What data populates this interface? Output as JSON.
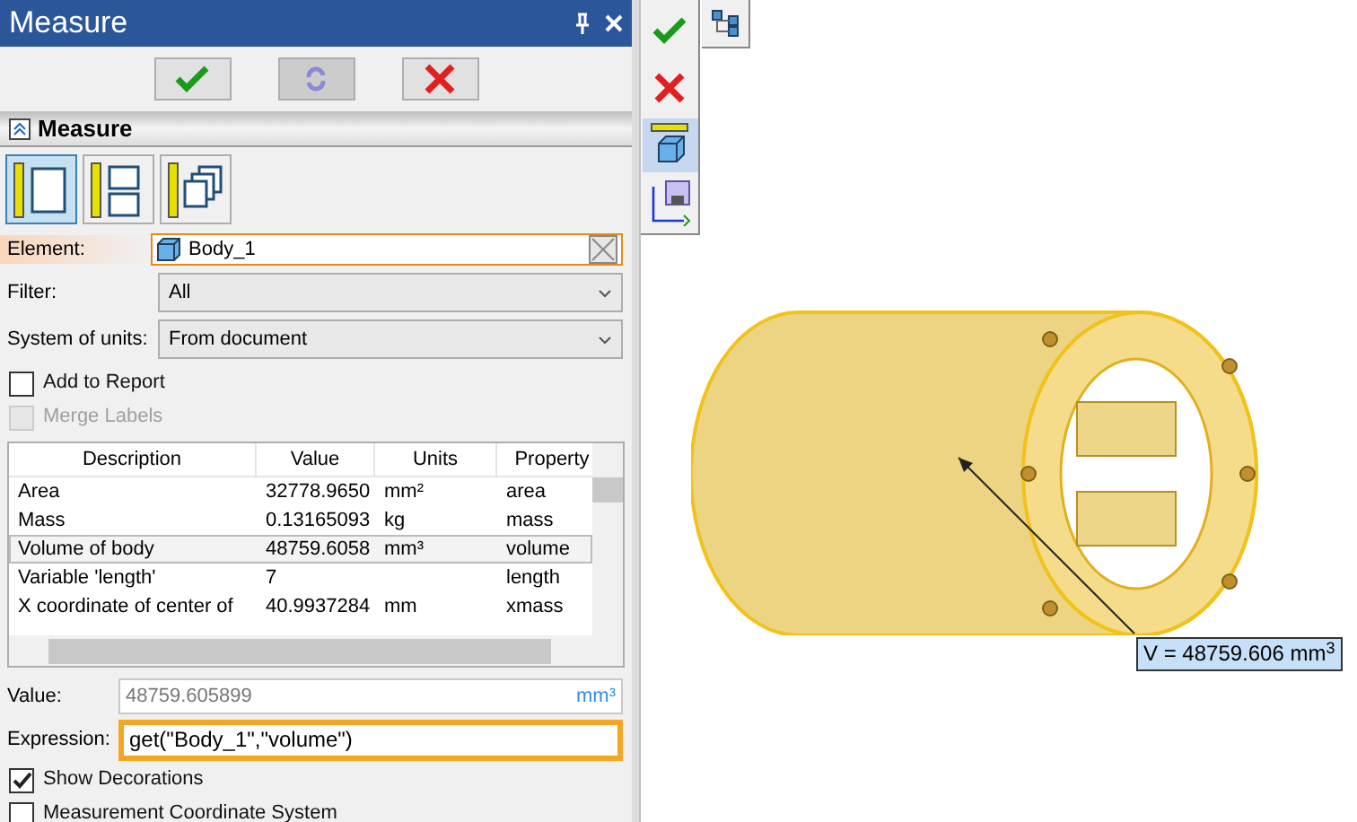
{
  "panel": {
    "title": "Measure",
    "section": "Measure",
    "expanded": true
  },
  "actions": [
    {
      "kind": "ok",
      "disabled": false
    },
    {
      "kind": "refresh",
      "disabled": true
    },
    {
      "kind": "cancel",
      "disabled": false
    }
  ],
  "modes": [
    {
      "kind": "single",
      "selected": true
    },
    {
      "kind": "split",
      "selected": false
    },
    {
      "kind": "stack",
      "selected": false
    }
  ],
  "element": {
    "label": "Element:",
    "value": "Body_1"
  },
  "filter": {
    "label": "Filter:",
    "value": "All"
  },
  "units": {
    "label": "System of units:",
    "value": "From document"
  },
  "options_top": [
    {
      "label": "Add to Report",
      "checked": false,
      "disabled": false
    },
    {
      "label": "Merge Labels",
      "checked": false,
      "disabled": true
    }
  ],
  "table": {
    "columns": [
      "Description",
      "Value",
      "Units",
      "Property"
    ],
    "rows": [
      {
        "cells": [
          "Area",
          "32778.9650",
          "mm²",
          "area"
        ],
        "selected": false
      },
      {
        "cells": [
          "Mass",
          "0.13165093",
          "kg",
          "mass"
        ],
        "selected": false
      },
      {
        "cells": [
          "Volume of body",
          "48759.6058",
          "mm³",
          "volume"
        ],
        "selected": true
      },
      {
        "cells": [
          "Variable 'length'",
          "7",
          "",
          "length"
        ],
        "selected": false
      },
      {
        "cells": [
          "X coordinate of center of",
          "40.9937284",
          "mm",
          "xmass"
        ],
        "selected": false
      }
    ]
  },
  "value": {
    "label": "Value:",
    "value": "48759.605899",
    "unit": "mm³"
  },
  "expression": {
    "label": "Expression:",
    "value": "get(\"Body_1\",\"volume\")"
  },
  "options_bottom": [
    {
      "label": "Show Decorations",
      "checked": true,
      "disabled": false
    },
    {
      "label": "Measurement Coordinate System",
      "checked": false,
      "disabled": false
    }
  ],
  "viewport": {
    "tools": [
      {
        "kind": "ok",
        "selected": false
      },
      {
        "kind": "cancel",
        "selected": false
      },
      {
        "kind": "measure",
        "selected": true
      },
      {
        "kind": "save",
        "selected": false
      }
    ],
    "callout": "V = 48759.606 mm$^{3}$"
  }
}
